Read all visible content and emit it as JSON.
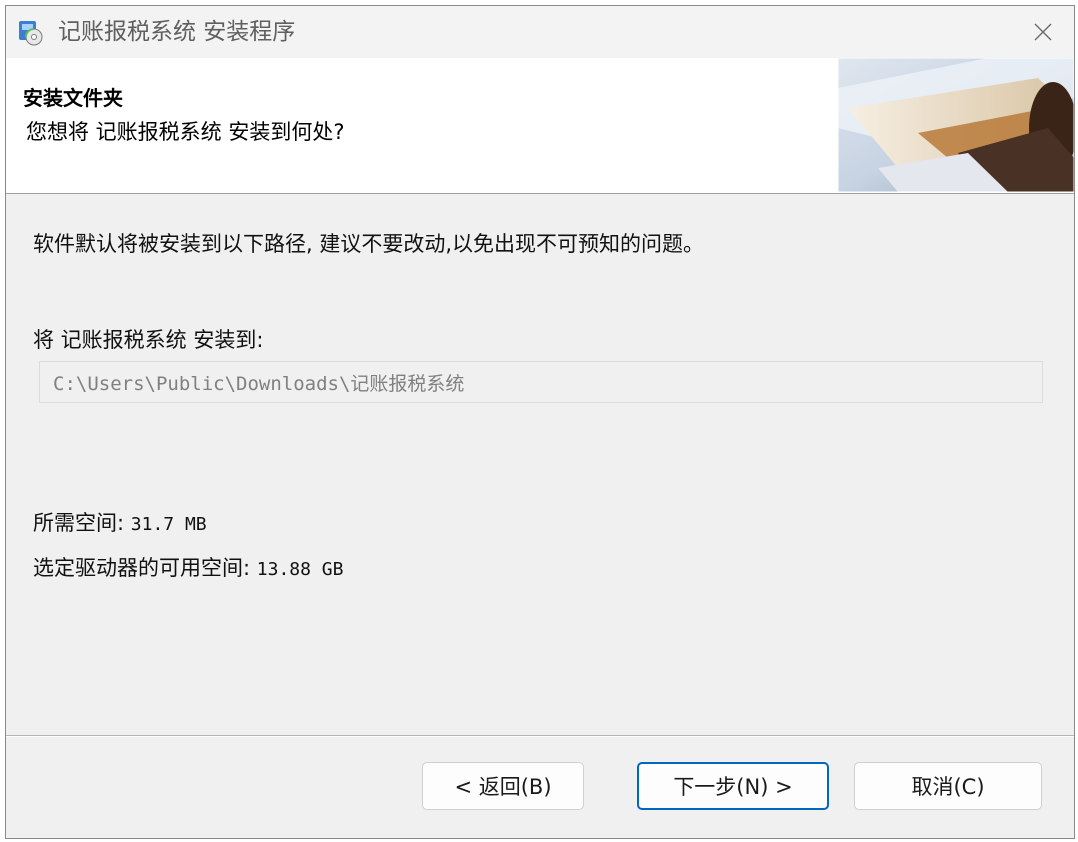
{
  "window": {
    "title": "记账报税系统 安装程序"
  },
  "header": {
    "title": "安装文件夹",
    "subtitle": "您想将 记账报税系统 安装到何处?"
  },
  "body": {
    "info": "软件默认将被安装到以下路径, 建议不要改动,以免出现不可预知的问题。",
    "install_to_label": "将 记账报税系统 安装到:",
    "install_path": "C:\\Users\\Public\\Downloads\\记账报税系统",
    "required_space_label": "所需空间:",
    "required_space_value": "31.7 MB",
    "free_space_label": "选定驱动器的可用空间:",
    "free_space_value": "13.88 GB"
  },
  "buttons": {
    "back": "< 返回(B)",
    "next": "下一步(N) >",
    "cancel": "取消(C)"
  },
  "icons": {
    "app": "installer-icon",
    "close": "close-icon"
  },
  "colors": {
    "accent": "#0067c0"
  }
}
